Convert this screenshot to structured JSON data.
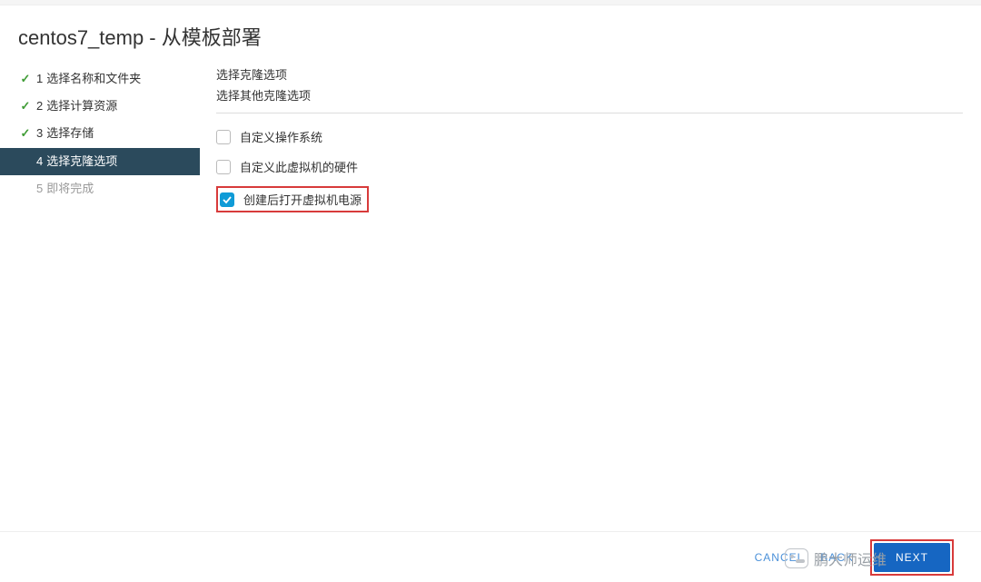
{
  "dialog": {
    "title": "centos7_temp - 从模板部署"
  },
  "sidebar": {
    "steps": [
      {
        "num": "1",
        "label": "选择名称和文件夹",
        "state": "done"
      },
      {
        "num": "2",
        "label": "选择计算资源",
        "state": "done"
      },
      {
        "num": "3",
        "label": "选择存储",
        "state": "done"
      },
      {
        "num": "4",
        "label": "选择克隆选项",
        "state": "active"
      },
      {
        "num": "5",
        "label": "即将完成",
        "state": "pending"
      }
    ]
  },
  "main": {
    "heading": "选择克隆选项",
    "subheading": "选择其他克隆选项",
    "options": [
      {
        "label": "自定义操作系统",
        "checked": false,
        "highlight": false
      },
      {
        "label": "自定义此虚拟机的硬件",
        "checked": false,
        "highlight": false
      },
      {
        "label": "创建后打开虚拟机电源",
        "checked": true,
        "highlight": true
      }
    ]
  },
  "footer": {
    "cancel": "CANCEL",
    "back": "BACK",
    "next": "NEXT"
  },
  "watermark": {
    "text": "鹏大师运维"
  }
}
